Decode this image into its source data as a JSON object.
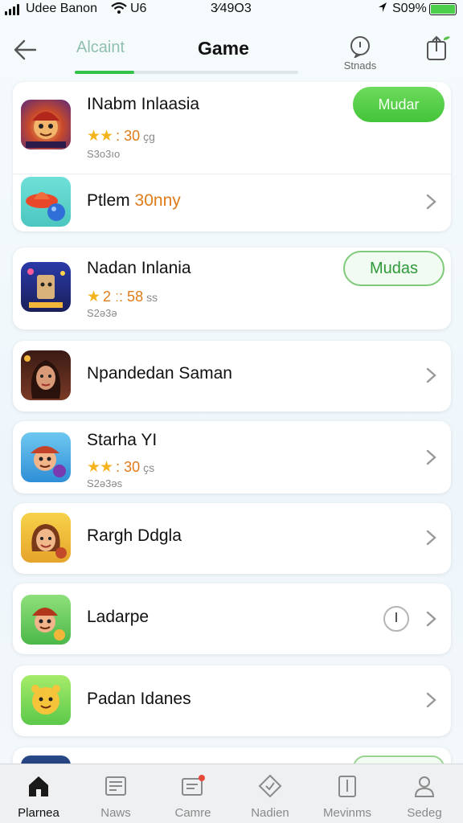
{
  "status_bar": {
    "carrier": "Udee Banon",
    "network": "U6",
    "time": "3⁄49О3",
    "battery_pct": "S09%"
  },
  "header": {
    "tab_left": "Alcaint",
    "title": "Game",
    "stands_label": "Stnads",
    "accent": "#34c24a"
  },
  "apps": [
    {
      "name": "INabm Inlaasia",
      "stars": "★★",
      "rating": ": 30",
      "unit": "ҫg",
      "size": "S3o3ıo",
      "action": "Mudar"
    },
    {
      "name_prefix": "Ptlem",
      "name_accent": "30nny"
    },
    {
      "name": "Nadan Inlania",
      "stars": "★",
      "rating": "2 ː: 58",
      "unit": "ss",
      "size": "S2ə3ə",
      "action": "Mudas"
    },
    {
      "name": "Npandedan Saman"
    },
    {
      "name": "Starha YI",
      "stars": "★★",
      "rating": ": 30",
      "unit": "ҫs",
      "size": "S2ə3əs"
    },
    {
      "name": "Rargh Ddgla"
    },
    {
      "name": "Ladarpe"
    },
    {
      "name": "Padan Idanes"
    }
  ],
  "bottom_nav": [
    {
      "label": "Plarnea",
      "icon": "home-icon",
      "active": true
    },
    {
      "label": "Naws",
      "icon": "news-icon",
      "active": false
    },
    {
      "label": "Camre",
      "icon": "chat-icon",
      "active": false
    },
    {
      "label": "Nadien",
      "icon": "tag-icon",
      "active": false
    },
    {
      "label": "Mevinms",
      "icon": "book-icon",
      "active": false
    },
    {
      "label": "Sedeg",
      "icon": "profile-icon",
      "active": false
    }
  ]
}
